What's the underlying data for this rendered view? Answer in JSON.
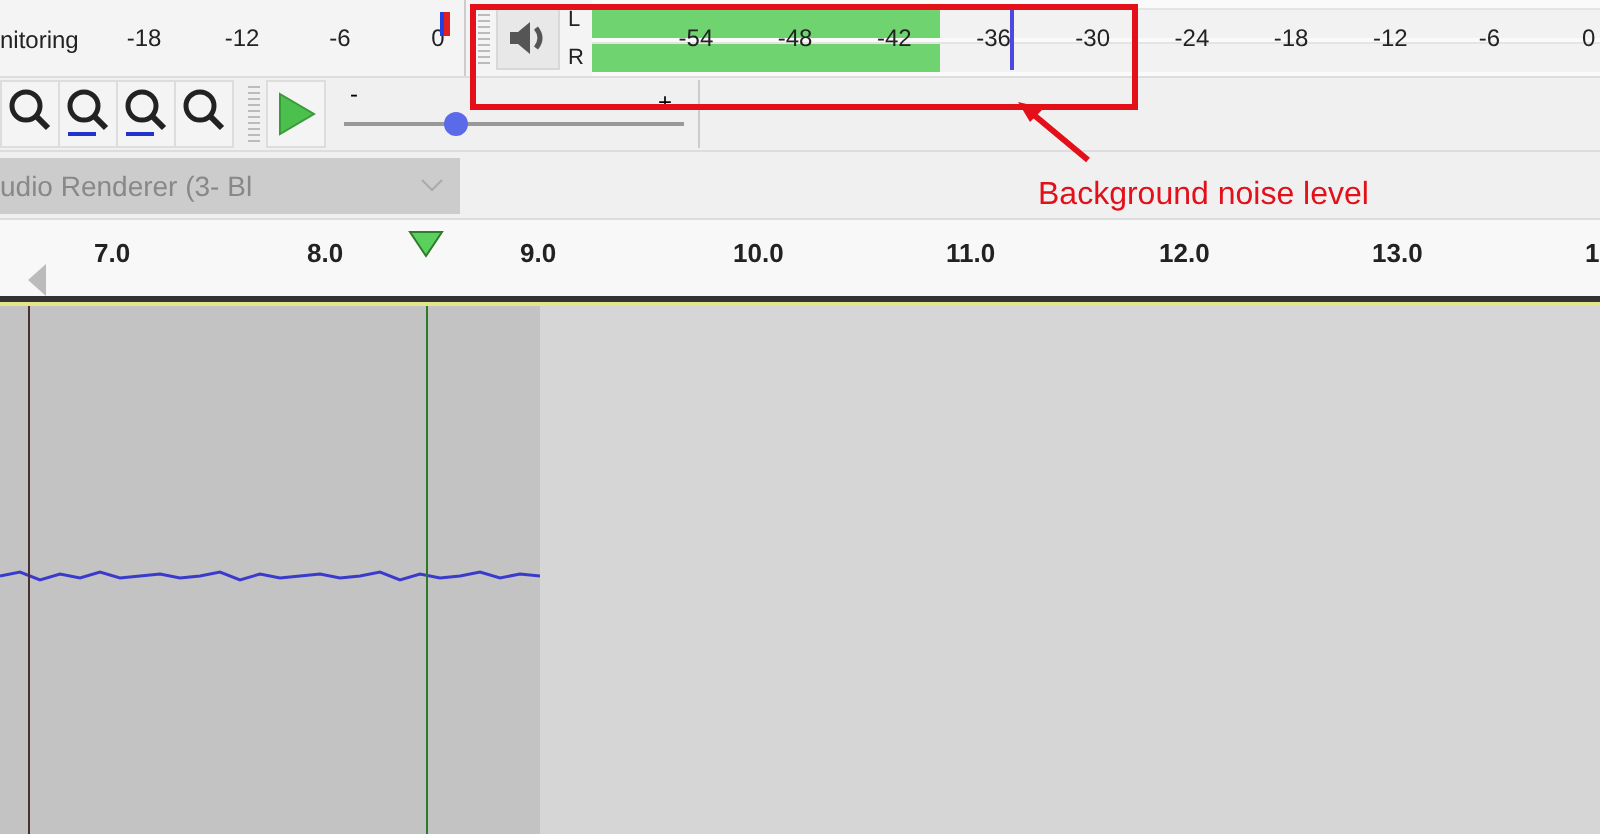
{
  "recording_meter": {
    "label": "nitoring",
    "scale": [
      "-18",
      "-12",
      "-6",
      "0"
    ]
  },
  "playback_meter": {
    "channels": [
      {
        "name": "L",
        "level": 0.345
      },
      {
        "name": "R",
        "level": 0.345
      }
    ],
    "peak": {
      "level": 0.415
    },
    "scale": [
      "-54",
      "-48",
      "-42",
      "-36",
      "-30",
      "-24",
      "-18",
      "-12",
      "-6",
      "0"
    ]
  },
  "play_speed": {
    "minus": "-",
    "plus": "+",
    "level": 0.33
  },
  "device": {
    "value": "udio Renderer (3- Bl"
  },
  "annotation": {
    "text": "Background noise level"
  },
  "timeline": {
    "labels": [
      "7.0",
      "8.0",
      "9.0",
      "10.0",
      "11.0",
      "12.0",
      "13.0",
      "1"
    ]
  }
}
